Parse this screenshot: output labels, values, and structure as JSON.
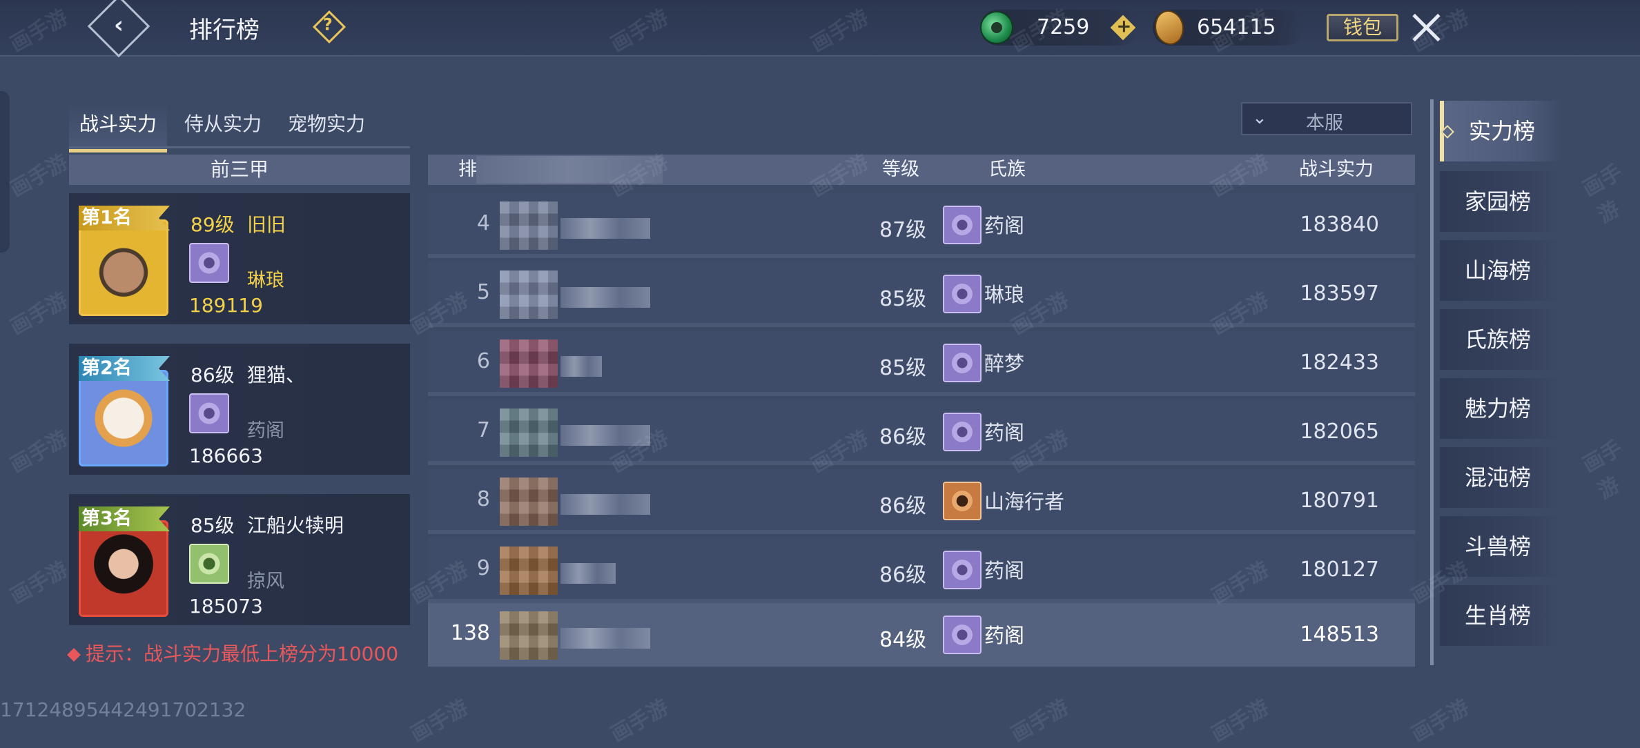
{
  "header": {
    "title": "排行榜",
    "help": "?",
    "jade_amount": "7259",
    "plus": "+",
    "gold_amount": "654115",
    "wallet_label": "钱包"
  },
  "tabs": [
    "战斗实力",
    "侍从实力",
    "宠物实力"
  ],
  "active_tab": "战斗实力",
  "top3": {
    "header": "前三甲",
    "entries": [
      {
        "rank_label": "第1名",
        "level": "89级",
        "name": "旧旧",
        "clan": "琳琅",
        "power": "189119"
      },
      {
        "rank_label": "第2名",
        "level": "86级",
        "name": "狸猫、",
        "clan": "药阁",
        "power": "186663"
      },
      {
        "rank_label": "第3名",
        "level": "85级",
        "name": "江船火犊明",
        "clan": "掠风",
        "power": "185073"
      }
    ]
  },
  "hint": "提示：战斗实力最低上榜分为10000",
  "server_filter": {
    "chevron": "⌄",
    "value": "本服"
  },
  "list": {
    "columns": {
      "rank": "排",
      "level": "等级",
      "clan": "氏族",
      "power": "战斗实力"
    },
    "rows": [
      {
        "rank": "4",
        "level": "87级",
        "clan": "药阁",
        "power": "183840",
        "clan_icon": "clan-purple"
      },
      {
        "rank": "5",
        "level": "85级",
        "clan": "琳琅",
        "power": "183597",
        "clan_icon": "clan-purple"
      },
      {
        "rank": "6",
        "level": "85级",
        "clan": "醉梦",
        "power": "182433",
        "clan_icon": "clan-purple"
      },
      {
        "rank": "7",
        "level": "86级",
        "clan": "药阁",
        "power": "182065",
        "clan_icon": "clan-purple"
      },
      {
        "rank": "8",
        "level": "86级",
        "clan": "山海行者",
        "power": "180791",
        "clan_icon": "clan-orange"
      },
      {
        "rank": "9",
        "level": "86级",
        "clan": "药阁",
        "power": "180127",
        "clan_icon": "clan-purple"
      }
    ],
    "me": {
      "rank": "138",
      "level": "84级",
      "clan": "药阁",
      "power": "148513",
      "clan_icon": "clan-purple"
    }
  },
  "sidebar": {
    "items": [
      "实力榜",
      "家园榜",
      "山海榜",
      "氏族榜",
      "魅力榜",
      "混沌榜",
      "斗兽榜",
      "生肖榜"
    ],
    "active": "实力榜"
  },
  "uid": "17124895442491702132",
  "watermark": "画手游"
}
